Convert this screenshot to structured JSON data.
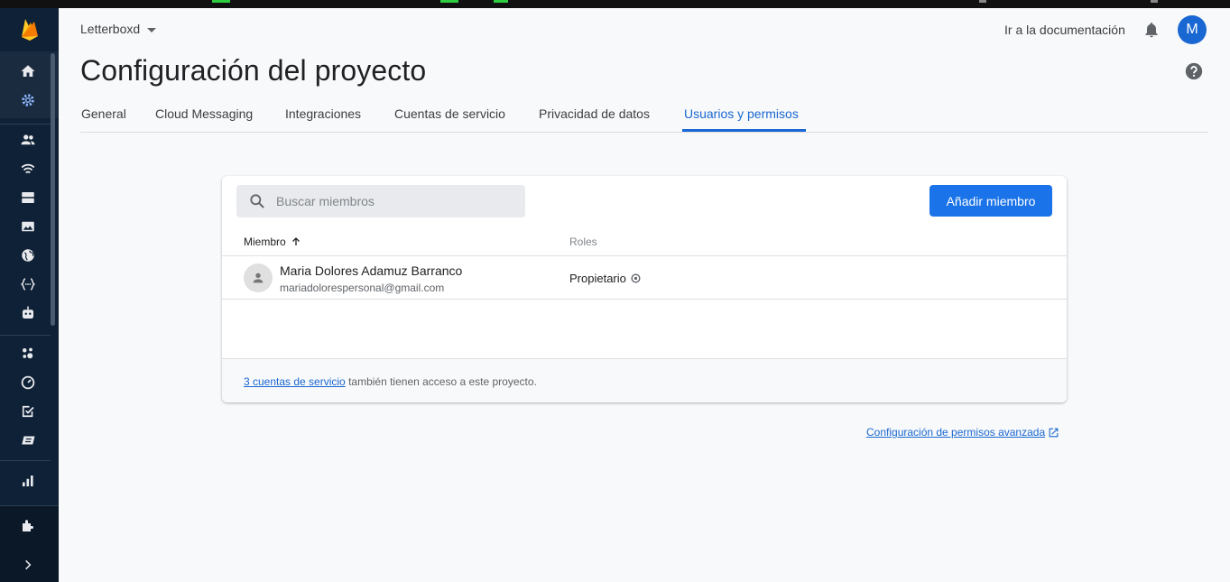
{
  "colors": {
    "accent": "#1a73e8",
    "rail_bg": "#0f2136",
    "tab_active": "#1967d2"
  },
  "rail": {
    "icons": [
      "home-icon",
      "settings-icon",
      "users-icon",
      "realtime-icon",
      "storage-icon",
      "image-icon",
      "globe-icon",
      "functions-icon",
      "robot-icon",
      "extensions-icon",
      "speedometer-icon",
      "checklist-icon",
      "test-lab-icon",
      "analytics-icon",
      "puzzle-icon",
      "chevron-right-icon"
    ]
  },
  "header": {
    "project_name": "Letterboxd",
    "doc_link": "Ir a la documentación",
    "avatar_initial": "M"
  },
  "page": {
    "title": "Configuración del proyecto",
    "tabs": [
      {
        "label": "General"
      },
      {
        "label": "Cloud Messaging"
      },
      {
        "label": "Integraciones"
      },
      {
        "label": "Cuentas de servicio"
      },
      {
        "label": "Privacidad de datos"
      },
      {
        "label": "Usuarios y permisos"
      }
    ],
    "active_tab": "Usuarios y permisos"
  },
  "members": {
    "search_placeholder": "Buscar miembros",
    "add_button": "Añadir miembro",
    "columns": {
      "member": "Miembro",
      "roles": "Roles"
    },
    "rows": [
      {
        "name": "Maria Dolores Adamuz Barranco",
        "email": "mariadolorespersonal@gmail.com",
        "role": "Propietario"
      }
    ],
    "footer_link": "3 cuentas de servicio",
    "footer_text": " también tienen acceso a este proyecto."
  },
  "advanced_link": "Configuración de permisos avanzada"
}
